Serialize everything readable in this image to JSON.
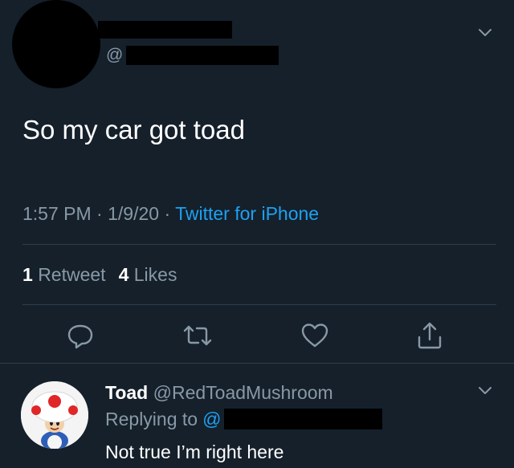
{
  "main_tweet": {
    "handle_prefix": "@",
    "text": "So my car got toad",
    "time": "1:57 PM",
    "date": "1/9/20",
    "separator": "·",
    "source": "Twitter for iPhone",
    "retweet_count": "1",
    "retweet_label": "Retweet",
    "like_count": "4",
    "like_label": "Likes"
  },
  "reply_tweet": {
    "name": "Toad",
    "handle": "@RedToadMushroom",
    "replying_label": "Replying to",
    "replying_at": "@",
    "text": "Not true I’m right here"
  },
  "actions": [
    "reply-icon",
    "retweet-icon",
    "like-icon",
    "share-icon"
  ],
  "colors": {
    "background": "#15202b",
    "text_primary": "#ffffff",
    "text_secondary": "#8899a6",
    "accent": "#1da1f2",
    "divider": "#2f3d4b"
  }
}
